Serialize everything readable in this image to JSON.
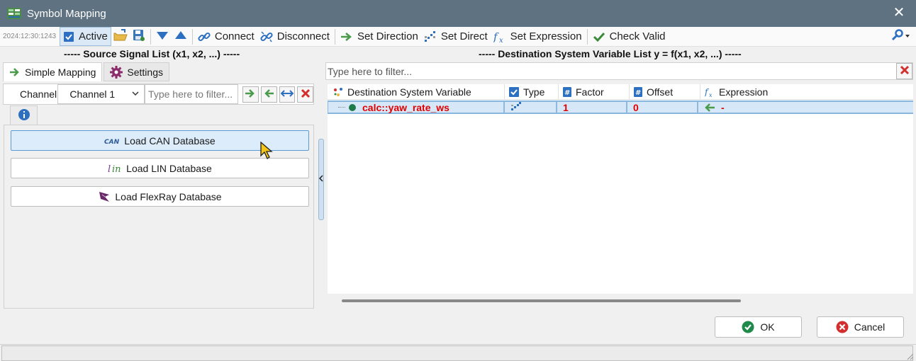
{
  "window": {
    "title": "Symbol Mapping",
    "close_glyph": "✕"
  },
  "toolbar": {
    "timestamp": "2024:12:30:1243",
    "active_label": "Active",
    "connect_label": "Connect",
    "disconnect_label": "Disconnect",
    "set_direction_label": "Set Direction",
    "set_direct_label": "Set Direct",
    "set_expression_label": "Set Expression",
    "check_valid_label": "Check Valid"
  },
  "headers": {
    "source": "----- Source Signal List (x1, x2, ...) -----",
    "destination": "----- Destination System Variable List y = f(x1, x2, ...) -----"
  },
  "left": {
    "tabs": [
      "Simple Mapping",
      "Settings"
    ],
    "channel_label": "Channel",
    "channel_value": "Channel 1",
    "filter_placeholder": "Type here to filter...",
    "load_buttons": [
      "Load CAN Database",
      "Load LIN Database",
      "Load FlexRay Database"
    ]
  },
  "right": {
    "filter_placeholder": "Type here to filter...",
    "columns": [
      "Destination System Variable",
      "Type",
      "Factor",
      "Offset",
      "Expression"
    ],
    "rows": [
      {
        "variable": "calc::yaw_rate_ws",
        "factor": "1",
        "offset": "0",
        "expression": "-"
      }
    ]
  },
  "dialog": {
    "ok_label": "OK",
    "cancel_label": "Cancel"
  },
  "colors": {
    "titlebar": "#5f7281",
    "accent": "#3a8a3a",
    "error": "#d32f2f",
    "selection": "#d6e8f7"
  }
}
